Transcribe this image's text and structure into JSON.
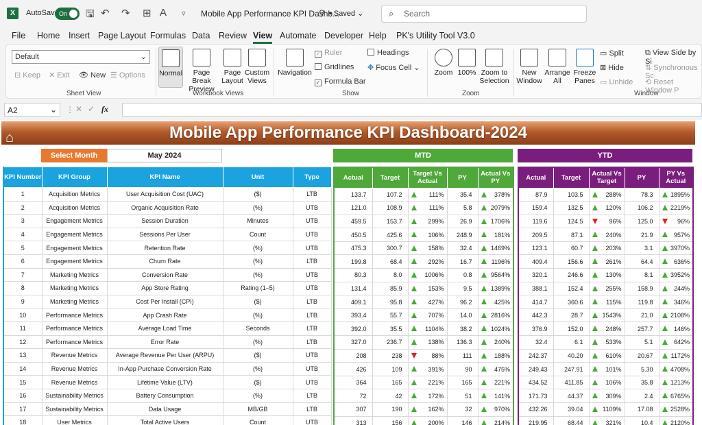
{
  "titlebar": {
    "autosave": "AutoSave",
    "toggle": "On",
    "doc_title": "Mobile App Performance KPI Dashb...",
    "saved": "• Saved ⌄",
    "search_placeholder": "Search"
  },
  "menu": [
    "File",
    "Home",
    "Insert",
    "Page Layout",
    "Formulas",
    "Data",
    "Review",
    "View",
    "Automate",
    "Developer",
    "Help",
    "PK's Utility Tool V3.0"
  ],
  "ribbon": {
    "sheet_view": {
      "select": "Default",
      "keep": "Keep",
      "exit": "Exit",
      "new": "New",
      "options": "Options",
      "label": "Sheet View"
    },
    "workbook_views": {
      "normal": "Normal",
      "page_break": "Page Break Preview",
      "page_layout": "Page Layout",
      "custom": "Custom Views",
      "label": "Workbook Views"
    },
    "show": {
      "navigation": "Navigation",
      "ruler": "Ruler",
      "gridlines": "Gridlines",
      "formula_bar": "Formula Bar",
      "headings": "Headings",
      "focus_cell": "Focus Cell",
      "label": "Show"
    },
    "zoom": {
      "zoom": "Zoom",
      "hundred": "100%",
      "zoom_sel": "Zoom to Selection",
      "label": "Zoom"
    },
    "window": {
      "new_window": "New Window",
      "arrange": "Arrange All",
      "freeze": "Freeze Panes",
      "split": "Split",
      "hide": "Hide",
      "unhide": "Unhide",
      "view_side": "View Side by Si",
      "sync": "Synchronous Sc",
      "reset": "Reset Window P",
      "label": "Window"
    }
  },
  "formula": {
    "namebox": "A2",
    "fx": "fx"
  },
  "dashboard": {
    "title": "Mobile App Performance KPI Dashboard-2024",
    "select_month_label": "Select Month",
    "month": "May 2024",
    "mtd": "MTD",
    "ytd": "YTD",
    "kpi_headers": [
      "KPI Number",
      "KPI Group",
      "KPI Name",
      "Unit",
      "Type"
    ],
    "mtd_headers": [
      "Actual",
      "Target",
      "Target Vs Actual",
      "PY",
      "Actual Vs PY"
    ],
    "ytd_headers": [
      "Actual",
      "Target",
      "Actual Vs Target",
      "PY",
      "PY Vs Actual"
    ],
    "rows": [
      {
        "n": "1",
        "g": "Acquisition Metrics",
        "k": "User Acquisition Cost (UAC)",
        "u": "($)",
        "t": "LTB",
        "ma": "133.7",
        "mt": "107.2",
        "mtv": "111%",
        "mtd": "up",
        "mp": "35.4",
        "mpv": "378%",
        "mpd": "up",
        "ya": "87.9",
        "yt": "103.5",
        "ytv": "288%",
        "ytd": "up",
        "yp": "78.3",
        "ypv": "1895%",
        "ypd": "up"
      },
      {
        "n": "2",
        "g": "Acquisition Metrics",
        "k": "Organic Acquisition Rate",
        "u": "(%)",
        "t": "UTB",
        "ma": "121.0",
        "mt": "108.9",
        "mtv": "111%",
        "mtd": "up",
        "mp": "5.8",
        "mpv": "2079%",
        "mpd": "up",
        "ya": "159.4",
        "yt": "132.5",
        "ytv": "120%",
        "ytd": "up",
        "yp": "106.2",
        "ypv": "2219%",
        "ypd": "up"
      },
      {
        "n": "3",
        "g": "Engagement Metrics",
        "k": "Session Duration",
        "u": "Minutes",
        "t": "UTB",
        "ma": "459.5",
        "mt": "153.7",
        "mtv": "299%",
        "mtd": "up",
        "mp": "26.9",
        "mpv": "1706%",
        "mpd": "up",
        "ya": "119.6",
        "yt": "124.5",
        "ytv": "96%",
        "ytd": "down",
        "yp": "125.0",
        "ypv": "96%",
        "ypd": "down"
      },
      {
        "n": "4",
        "g": "Engagement Metrics",
        "k": "Sessions Per User",
        "u": "Count",
        "t": "UTB",
        "ma": "450.5",
        "mt": "425.6",
        "mtv": "106%",
        "mtd": "up",
        "mp": "248.9",
        "mpv": "181%",
        "mpd": "up",
        "ya": "209.5",
        "yt": "87.1",
        "ytv": "240%",
        "ytd": "up",
        "yp": "21.9",
        "ypv": "957%",
        "ypd": "up"
      },
      {
        "n": "5",
        "g": "Engagement Metrics",
        "k": "Retention Rate",
        "u": "(%)",
        "t": "UTB",
        "ma": "475.3",
        "mt": "300.7",
        "mtv": "158%",
        "mtd": "up",
        "mp": "32.4",
        "mpv": "1469%",
        "mpd": "up",
        "ya": "123.1",
        "yt": "60.7",
        "ytv": "203%",
        "ytd": "up",
        "yp": "3.1",
        "ypv": "3970%",
        "ypd": "up"
      },
      {
        "n": "6",
        "g": "Engagement Metrics",
        "k": "Churn Rate",
        "u": "(%)",
        "t": "LTB",
        "ma": "199.8",
        "mt": "68.4",
        "mtv": "292%",
        "mtd": "up",
        "mp": "16.7",
        "mpv": "1196%",
        "mpd": "up",
        "ya": "409.4",
        "yt": "156.6",
        "ytv": "261%",
        "ytd": "up",
        "yp": "64.4",
        "ypv": "636%",
        "ypd": "up"
      },
      {
        "n": "7",
        "g": "Marketing Metrics",
        "k": "Conversion Rate",
        "u": "(%)",
        "t": "UTB",
        "ma": "80.3",
        "mt": "8.0",
        "mtv": "1006%",
        "mtd": "up",
        "mp": "0.8",
        "mpv": "9564%",
        "mpd": "up",
        "ya": "320.1",
        "yt": "246.6",
        "ytv": "130%",
        "ytd": "up",
        "yp": "8.1",
        "ypv": "3952%",
        "ypd": "up"
      },
      {
        "n": "8",
        "g": "Marketing Metrics",
        "k": "App Store Rating",
        "u": "Rating (1–5)",
        "t": "UTB",
        "ma": "131.4",
        "mt": "85.9",
        "mtv": "153%",
        "mtd": "up",
        "mp": "9.5",
        "mpv": "1389%",
        "mpd": "up",
        "ya": "388.1",
        "yt": "152.4",
        "ytv": "255%",
        "ytd": "up",
        "yp": "158.9",
        "ypv": "244%",
        "ypd": "up"
      },
      {
        "n": "9",
        "g": "Marketing Metrics",
        "k": "Cost Per Install (CPI)",
        "u": "($)",
        "t": "LTB",
        "ma": "409.1",
        "mt": "95.8",
        "mtv": "427%",
        "mtd": "up",
        "mp": "96.2",
        "mpv": "425%",
        "mpd": "up",
        "ya": "414.7",
        "yt": "360.6",
        "ytv": "115%",
        "ytd": "up",
        "yp": "119.8",
        "ypv": "346%",
        "ypd": "up"
      },
      {
        "n": "10",
        "g": "Performance Metrics",
        "k": "App Crash Rate",
        "u": "(%)",
        "t": "LTB",
        "ma": "393.4",
        "mt": "55.7",
        "mtv": "707%",
        "mtd": "up",
        "mp": "14.0",
        "mpv": "2816%",
        "mpd": "up",
        "ya": "442.3",
        "yt": "28.7",
        "ytv": "1543%",
        "ytd": "up",
        "yp": "21.0",
        "ypv": "2108%",
        "ypd": "up"
      },
      {
        "n": "11",
        "g": "Performance Metrics",
        "k": "Average Load Time",
        "u": "Seconds",
        "t": "LTB",
        "ma": "392.0",
        "mt": "35.5",
        "mtv": "1104%",
        "mtd": "up",
        "mp": "38.2",
        "mpv": "1024%",
        "mpd": "up",
        "ya": "376.9",
        "yt": "152.0",
        "ytv": "248%",
        "ytd": "up",
        "yp": "257.7",
        "ypv": "146%",
        "ypd": "up"
      },
      {
        "n": "12",
        "g": "Performance Metrics",
        "k": "Error Rate",
        "u": "(%)",
        "t": "LTB",
        "ma": "327.0",
        "mt": "236.7",
        "mtv": "138%",
        "mtd": "up",
        "mp": "136.3",
        "mpv": "240%",
        "mpd": "up",
        "ya": "32.4",
        "yt": "6.1",
        "ytv": "533%",
        "ytd": "up",
        "yp": "5.1",
        "ypv": "642%",
        "ypd": "up"
      },
      {
        "n": "13",
        "g": "Revenue Metrics",
        "k": "Average Revenue Per User (ARPU)",
        "u": "($)",
        "t": "UTB",
        "ma": "208",
        "mt": "238",
        "mtv": "88%",
        "mtd": "down",
        "mp": "111",
        "mpv": "188%",
        "mpd": "up",
        "ya": "242.37",
        "yt": "40.20",
        "ytv": "610%",
        "ytd": "up",
        "yp": "20.67",
        "ypv": "1172%",
        "ypd": "up"
      },
      {
        "n": "14",
        "g": "Revenue Metrics",
        "k": "In-App Purchase Conversion Rate",
        "u": "(%)",
        "t": "UTB",
        "ma": "426",
        "mt": "109",
        "mtv": "391%",
        "mtd": "up",
        "mp": "90",
        "mpv": "475%",
        "mpd": "up",
        "ya": "249.43",
        "yt": "247.91",
        "ytv": "101%",
        "ytd": "up",
        "yp": "5.30",
        "ypv": "4708%",
        "ypd": "up"
      },
      {
        "n": "15",
        "g": "Revenue Metrics",
        "k": "Lifetime Value (LTV)",
        "u": "($)",
        "t": "UTB",
        "ma": "364",
        "mt": "165",
        "mtv": "221%",
        "mtd": "up",
        "mp": "165",
        "mpv": "221%",
        "mpd": "up",
        "ya": "434.52",
        "yt": "411.85",
        "ytv": "106%",
        "ytd": "up",
        "yp": "35.8",
        "ypv": "1213%",
        "ypd": "up"
      },
      {
        "n": "16",
        "g": "Sustainability Metrics",
        "k": "Battery Consumption",
        "u": "(%)",
        "t": "LTB",
        "ma": "72",
        "mt": "42",
        "mtv": "172%",
        "mtd": "up",
        "mp": "51",
        "mpv": "141%",
        "mpd": "up",
        "ya": "171.73",
        "yt": "44.37",
        "ytv": "309%",
        "ytd": "up",
        "yp": "2.4",
        "ypv": "6765%",
        "ypd": "up"
      },
      {
        "n": "17",
        "g": "Sustainability Metrics",
        "k": "Data Usage",
        "u": "MB/GB",
        "t": "LTB",
        "ma": "307",
        "mt": "190",
        "mtv": "162%",
        "mtd": "up",
        "mp": "32",
        "mpv": "970%",
        "mpd": "up",
        "ya": "432.26",
        "yt": "39.04",
        "ytv": "1109%",
        "ytd": "up",
        "yp": "17.08",
        "ypv": "2528%",
        "ypd": "up"
      },
      {
        "n": "18",
        "g": "User Metrics",
        "k": "Total Active Users",
        "u": "Count",
        "t": "UTB",
        "ma": "313",
        "mt": "156",
        "mtv": "200%",
        "mtd": "up",
        "mp": "146",
        "mpv": "214%",
        "mpd": "up",
        "ya": "219.95",
        "yt": "68.44",
        "ytv": "321%",
        "ytd": "up",
        "yp": "10.4",
        "ypv": "2120%",
        "ypd": "up"
      }
    ]
  },
  "colors": {
    "excel_green": "#1d6f42",
    "kpi_blue": "#1aa3df",
    "mtd_green": "#4fa83a",
    "ytd_purple": "#7a1e7e",
    "select_orange": "#e8792f",
    "up": "#4aa83a",
    "down": "#e02020"
  }
}
